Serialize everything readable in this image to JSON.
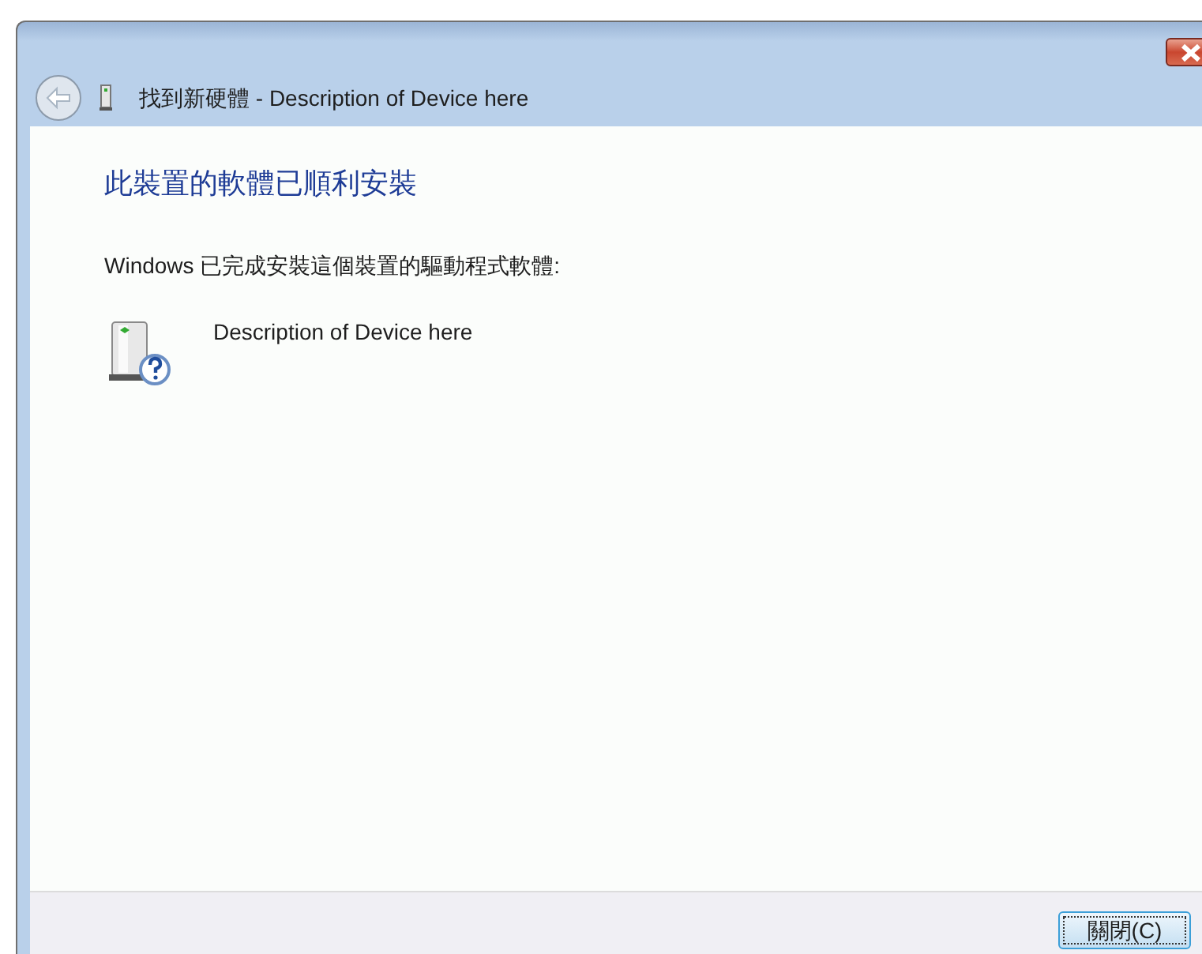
{
  "window": {
    "title": "找到新硬體 - Description of Device here"
  },
  "heading": "此裝置的軟體已順利安裝",
  "message": "Windows 已完成安裝這個裝置的驅動程式軟體:",
  "device": {
    "name": "Description of Device here"
  },
  "buttons": [
    {
      "label": "關閉(C)",
      "default": true
    }
  ]
}
